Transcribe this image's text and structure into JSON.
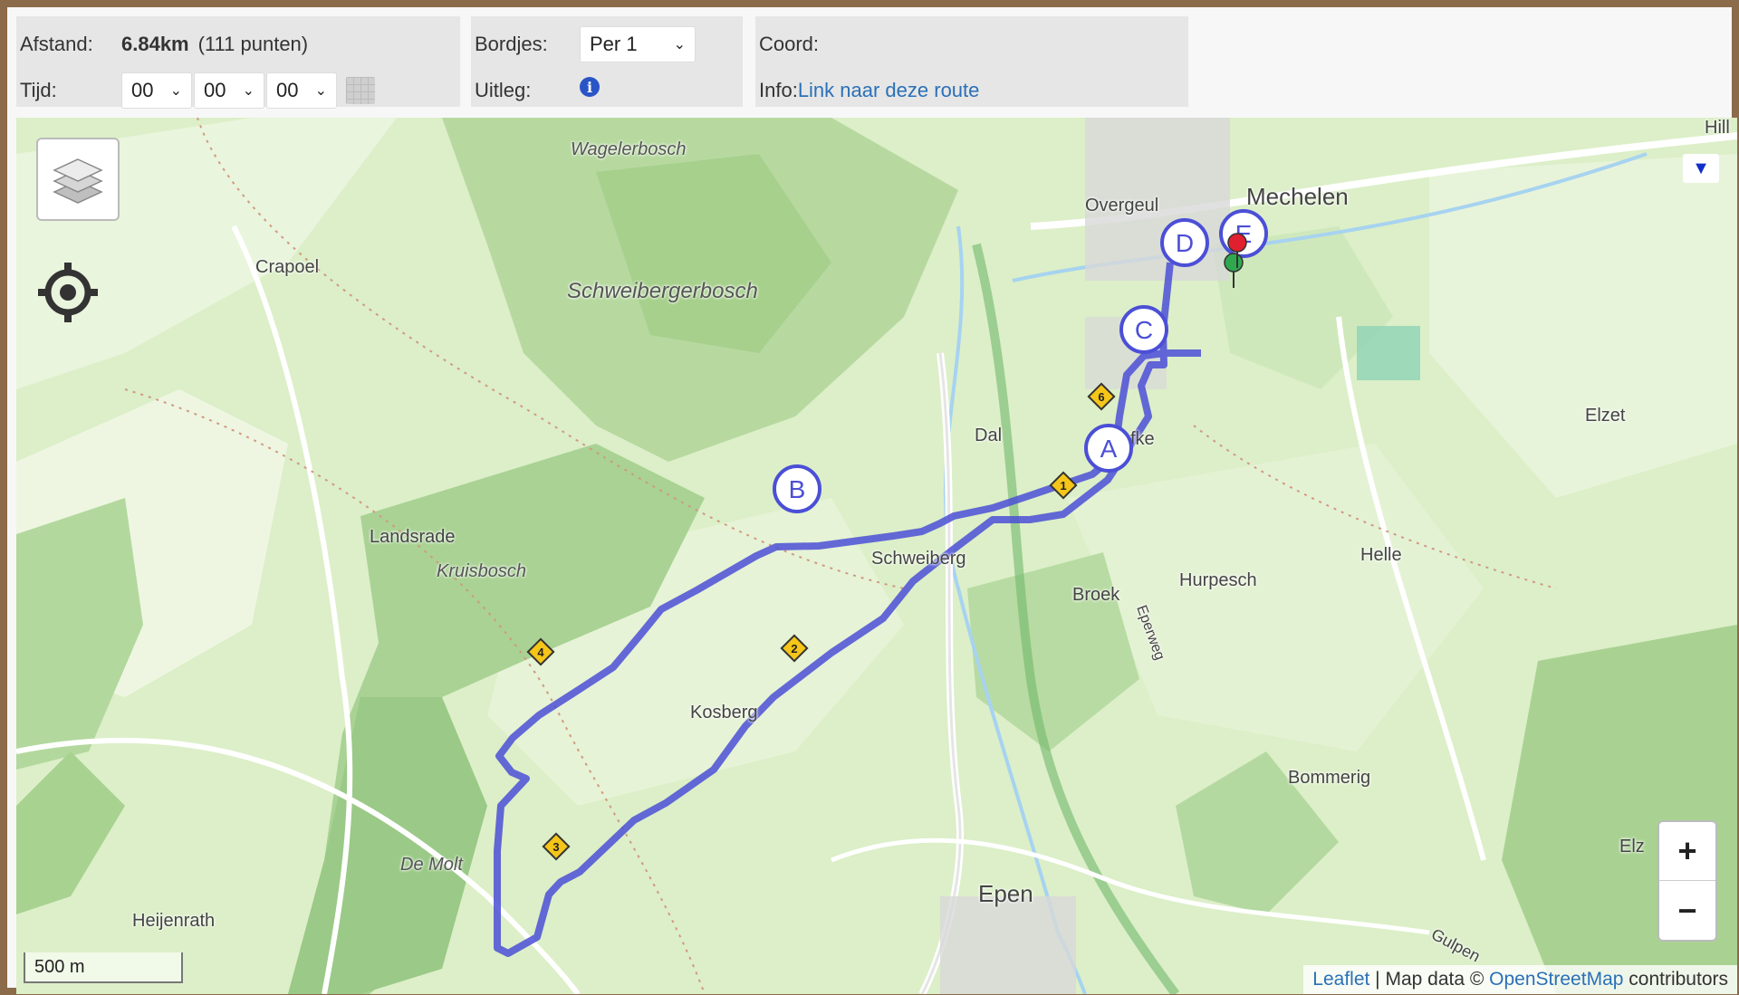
{
  "toolbar": {
    "distance_label": "Afstand:",
    "distance_value": "6.84km",
    "distance_points": "(111 punten)",
    "time_label": "Tijd:",
    "time_hours": "00",
    "time_minutes": "00",
    "time_seconds": "00",
    "signs_label": "Bordjes:",
    "signs_value": "Per 1",
    "explain_label": "Uitleg:",
    "coord_label": "Coord:",
    "info_label": "Info:",
    "info_link": "Link naar deze route"
  },
  "map": {
    "places": {
      "mechelen": "Mechelen",
      "overgeul": "Overgeul",
      "crapoel": "Crapoel",
      "wagelerbosch": "Wagelerbosch",
      "schweibergerbosch": "Schweibergerbosch",
      "dal": "Dal",
      "landsrade": "Landsrade",
      "kruisbosch": "Kruisbosch",
      "schweiberg": "Schweiberg",
      "broek": "Broek",
      "hurpesch": "Hurpesch",
      "helle": "Helle",
      "elzet": "Elzet",
      "kosberg": "Kosberg",
      "bommerig": "Bommerig",
      "epen": "Epen",
      "de_molt": "De Molt",
      "heijenrath": "Heijenrath",
      "eperweg": "Eperweg",
      "fke": "fke",
      "hill": "Hill",
      "elz": "Elz",
      "gulpen": "Gulpen"
    },
    "waypoints": [
      "A",
      "B",
      "C",
      "D",
      "E"
    ],
    "signs": [
      "1",
      "2",
      "3",
      "4",
      "6"
    ],
    "route_color": "#4b4fd6",
    "start_color": "#2fa84f",
    "end_color": "#e0202f",
    "scale_label": "500 m",
    "zoom_in": "+",
    "zoom_out": "−",
    "attribution_leaflet": "Leaflet",
    "attribution_sep": " | Map data © ",
    "attribution_osm": "OpenStreetMap",
    "attribution_tail": " contributors",
    "layers_icon": "layers-icon",
    "locate_icon": "crosshair-icon",
    "dropdown_icon": "triangle-down-icon"
  }
}
